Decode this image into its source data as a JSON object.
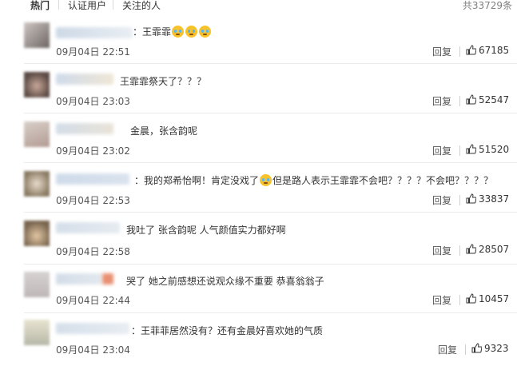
{
  "tabs": {
    "hot": "热门",
    "verified": "认证用户",
    "following": "关注的人"
  },
  "total": "共33729条",
  "colors": {
    "link": "#eb7350",
    "like_icon": "#333333"
  },
  "comments": [
    {
      "text": "：王霏霏",
      "emoji_count": 3,
      "time": "09月04日 22:51",
      "reply": "回复",
      "likes": "67185"
    },
    {
      "text": "王霏霏祭天了？？？",
      "time": "09月04日 23:03",
      "reply": "回复",
      "likes": "52547"
    },
    {
      "text": "金晨，张含韵呢",
      "time": "09月04日 23:02",
      "reply": "回复",
      "likes": "51520"
    },
    {
      "text_a": "：我的郑希怡啊！肯定没戏了",
      "text_b": "但是路人表示王霏霏不会吧？？？？不会吧？？？？",
      "time": "09月04日 22:53",
      "reply": "回复",
      "likes": "33837"
    },
    {
      "text": "我吐了 张含韵呢 人气颜值实力都好啊",
      "time": "09月04日 22:58",
      "reply": "回复",
      "likes": "28507"
    },
    {
      "text": "哭了 她之前感想还说观众缘不重要 恭喜翁翁子",
      "time": "09月04日 22:44",
      "reply": "回复",
      "likes": "10457"
    },
    {
      "text": "：王菲菲居然没有？还有金晨好喜欢她的气质",
      "time": "09月04日 23:04",
      "reply": "回复",
      "likes": "9323"
    }
  ]
}
